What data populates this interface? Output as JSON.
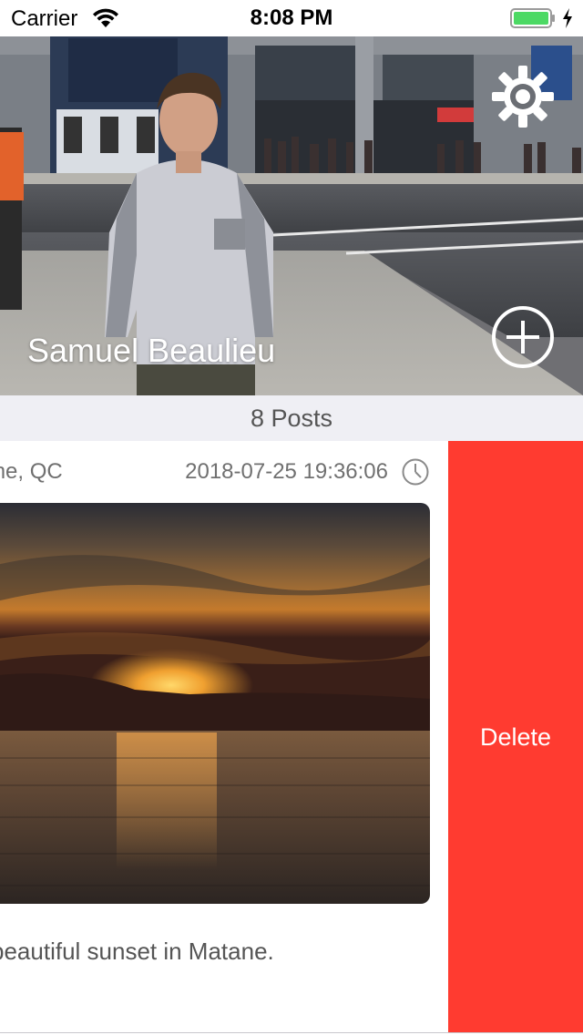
{
  "status_bar": {
    "carrier": "Carrier",
    "time": "8:08 PM",
    "icons": [
      "wifi-icon",
      "battery-icon",
      "charging-icon"
    ],
    "battery_color": "#4cd964"
  },
  "profile": {
    "name": "Samuel Beaulieu",
    "settings_icon": "gear-icon",
    "add_icon": "plus-circle-icon"
  },
  "posts_header": {
    "label": "8 Posts"
  },
  "post": {
    "location": "onne, QC",
    "datetime": "2018-07-25 19:36:06",
    "time_icon": "clock-icon",
    "caption": "beautiful sunset in Matane."
  },
  "swipe_action": {
    "label": "Delete",
    "color": "#ff3b30"
  }
}
